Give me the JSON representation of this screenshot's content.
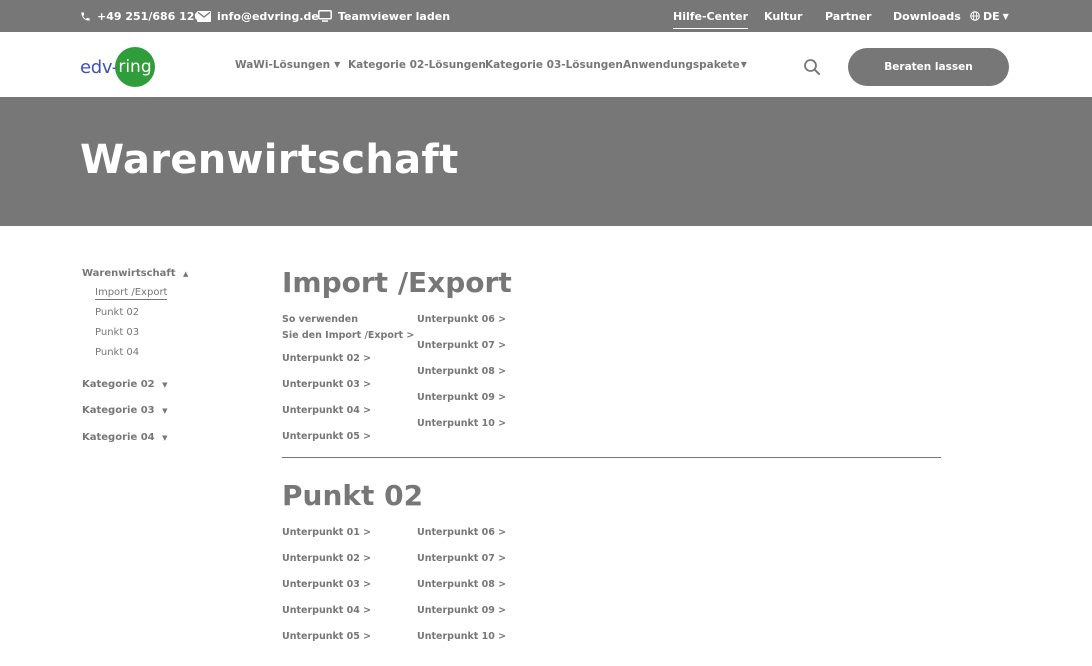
{
  "topbar": {
    "phone": "+49 251/686 120",
    "email": "info@edvring.de",
    "teamviewer": "Teamviewer laden",
    "links": [
      "Hilfe-Center",
      "Kultur",
      "Partner",
      "Downloads"
    ],
    "language": "DE"
  },
  "header": {
    "logo_part1": "edv-",
    "logo_part2": "ring",
    "nav": [
      "WaWi-Lösungen",
      "Kategorie 02-Lösungen",
      "Kategorie 03-Lösungen",
      "Anwendungspakete"
    ],
    "cta": "Beraten lassen"
  },
  "hero": {
    "title": "Warenwirtschaft"
  },
  "sidebar": {
    "cat1": "Warenwirtschaft",
    "subs": [
      "Import /Export",
      "Punkt 02",
      "Punkt 03",
      "Punkt 04"
    ],
    "cat2": "Kategorie 02",
    "cat3": "Kategorie 03",
    "cat4": "Kategorie 04"
  },
  "section1": {
    "title": "Import /Export",
    "left": [
      "So verwenden",
      "Sie den Import /Export >",
      "Unterpunkt 02 >",
      "Unterpunkt 03 >",
      "Unterpunkt 04 >",
      "Unterpunkt 05 >"
    ],
    "right": [
      "Unterpunkt 06 >",
      "Unterpunkt 07 >",
      "Unterpunkt 08 >",
      "Unterpunkt 09 >",
      "Unterpunkt 10 >"
    ]
  },
  "section2": {
    "title": "Punkt 02",
    "left": [
      "Unterpunkt 01 >",
      "Unterpunkt 02 >",
      "Unterpunkt 03 >",
      "Unterpunkt 04 >",
      "Unterpunkt 05 >"
    ],
    "right": [
      "Unterpunkt 06 >",
      "Unterpunkt 07 >",
      "Unterpunkt 08 >",
      "Unterpunkt 09 >",
      "Unterpunkt 10 >"
    ]
  },
  "colors": {
    "grey": "#777777",
    "logo_blue": "#3f4fbf",
    "logo_green": "#2e9d3a"
  }
}
